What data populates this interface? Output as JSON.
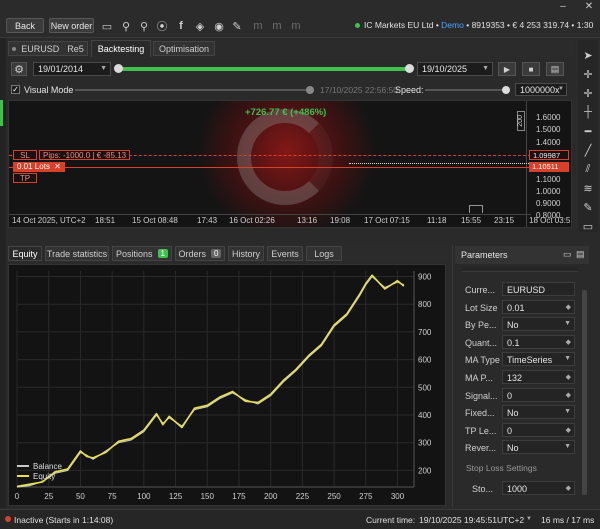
{
  "toolbar": {
    "back": "Back",
    "new_order": "New order",
    "broker": "IC Markets EU Ltd",
    "demo": "Demo",
    "account_info": "8919353 • € 4 253 319.74 • 1:30",
    "window_min": "–",
    "window_close": "✕"
  },
  "tabs": {
    "symbol": "EURUSD",
    "period": "Re5",
    "backtesting": "Backtesting",
    "optimisation": "Optimisation"
  },
  "backtest": {
    "start_date": "19/01/2014",
    "end_date": "19/10/2025",
    "progress": 1.0,
    "visual_mode": "Visual Mode",
    "current_time": "17/10/2025 22:56:50",
    "speed_label": "Speed:",
    "speed_value": "1000000x"
  },
  "mini_chart": {
    "pnl": "+726.77 € (+486%)",
    "sl": "SL",
    "sl_pips": "Pips: -1000.0",
    "sl_eur": "€ -85.13",
    "lots": "0.01 Lots",
    "tp": "TP",
    "price_ticks": [
      "1.6000",
      "1.5000",
      "1.4000",
      "1.3000",
      "1.2000",
      "1.1000",
      "1.0000",
      "0.9000",
      "0.8000"
    ],
    "sl_price": "1.09987",
    "entry_price": "1.10511",
    "time_ticks": [
      "14 Oct 2025, UTC+2",
      "18:51",
      "15 Oct 08:48",
      "17:43",
      "16 Oct 02:26",
      "13:16",
      "19:08",
      "17 Oct 07:15",
      "11:18",
      "15:55",
      "23:15",
      "18 Oct 03:5"
    ],
    "scale_label": "200"
  },
  "bottom_tabs": {
    "equity": "Equity",
    "trade_stats": "Trade statistics",
    "positions": "Positions",
    "positions_count": "1",
    "orders": "Orders",
    "orders_count": "0",
    "history": "History",
    "events": "Events",
    "logs": "Logs"
  },
  "chart_data": {
    "type": "line",
    "title": "",
    "xlabel": "",
    "ylabel": "",
    "xlim": [
      0,
      313
    ],
    "ylim": [
      140,
      920
    ],
    "x_ticks": [
      0,
      25,
      50,
      75,
      100,
      125,
      150,
      175,
      200,
      225,
      250,
      275,
      300
    ],
    "y_ticks": [
      200,
      300,
      400,
      500,
      600,
      700,
      800,
      900
    ],
    "grid": true,
    "legend": "bottom-left",
    "series": [
      {
        "name": "Balance",
        "color": "#c8c8c8",
        "x": [
          0,
          10,
          20,
          30,
          40,
          50,
          55,
          60,
          70,
          80,
          90,
          100,
          110,
          115,
          120,
          130,
          140,
          150,
          160,
          170,
          180,
          190,
          200,
          210,
          220,
          230,
          240,
          250,
          260,
          270,
          275,
          280,
          290,
          300,
          305
        ],
        "values": [
          140,
          145,
          160,
          190,
          200,
          265,
          255,
          240,
          270,
          300,
          310,
          340,
          400,
          370,
          390,
          360,
          420,
          430,
          460,
          480,
          455,
          440,
          470,
          520,
          560,
          610,
          650,
          720,
          760,
          830,
          870,
          900,
          860,
          880,
          870
        ]
      },
      {
        "name": "Equity",
        "color": "#e6e04a",
        "x": [
          0,
          10,
          20,
          30,
          40,
          50,
          55,
          60,
          70,
          80,
          90,
          100,
          110,
          115,
          120,
          130,
          140,
          150,
          160,
          170,
          180,
          190,
          200,
          210,
          220,
          230,
          240,
          250,
          260,
          270,
          275,
          280,
          290,
          300,
          305
        ],
        "values": [
          142,
          150,
          158,
          195,
          205,
          270,
          250,
          245,
          265,
          305,
          315,
          345,
          405,
          365,
          395,
          355,
          425,
          435,
          465,
          485,
          450,
          445,
          475,
          525,
          565,
          615,
          655,
          725,
          765,
          835,
          875,
          905,
          855,
          885,
          865
        ]
      }
    ]
  },
  "parameters": {
    "title": "Parameters",
    "rows": [
      {
        "label": "Curre...",
        "value": "EURUSD",
        "type": "text"
      },
      {
        "label": "Lot Size",
        "value": "0.01",
        "type": "num"
      },
      {
        "label": "By Pe...",
        "value": "No",
        "type": "select"
      },
      {
        "label": "Quant...",
        "value": "0.1",
        "type": "num"
      },
      {
        "label": "MA Type",
        "value": "TimeSeries",
        "type": "select"
      },
      {
        "label": "MA P...",
        "value": "132",
        "type": "num"
      },
      {
        "label": "Signal...",
        "value": "0",
        "type": "num"
      },
      {
        "label": "Fixed...",
        "value": "No",
        "type": "select"
      },
      {
        "label": "TP Le...",
        "value": "0",
        "type": "num"
      },
      {
        "label": "Rever...",
        "value": "No",
        "type": "select"
      }
    ],
    "section": "Stop Loss Settings",
    "sto_label": "Sto...",
    "sto_value": "1000"
  },
  "status": {
    "state": "Inactive (Starts in 1:14:08)",
    "time_label": "Current time:",
    "time_value": "19/10/2025 19:45:51",
    "tz": "UTC+2",
    "latency": "16 ms / 17 ms"
  },
  "colors": {
    "accent_green": "#3ec24d",
    "sl_red": "#d9402a",
    "demo_blue": "#4aa3ff"
  }
}
